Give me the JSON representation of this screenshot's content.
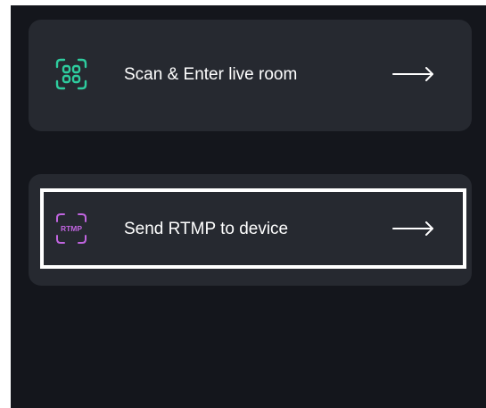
{
  "options": [
    {
      "label": "Scan & Enter live room",
      "icon": "scan-qr-icon",
      "icon_color": "#2ecc9e",
      "arrow": "arrow-right-icon"
    },
    {
      "label": "Send RTMP to device",
      "icon": "rtmp-icon",
      "icon_text": "RTMP",
      "icon_color": "#c165e0",
      "arrow": "arrow-right-icon"
    }
  ],
  "colors": {
    "background": "#14161c",
    "card": "#262930",
    "text": "#ffffff",
    "selection_outline": "#ffffff"
  }
}
